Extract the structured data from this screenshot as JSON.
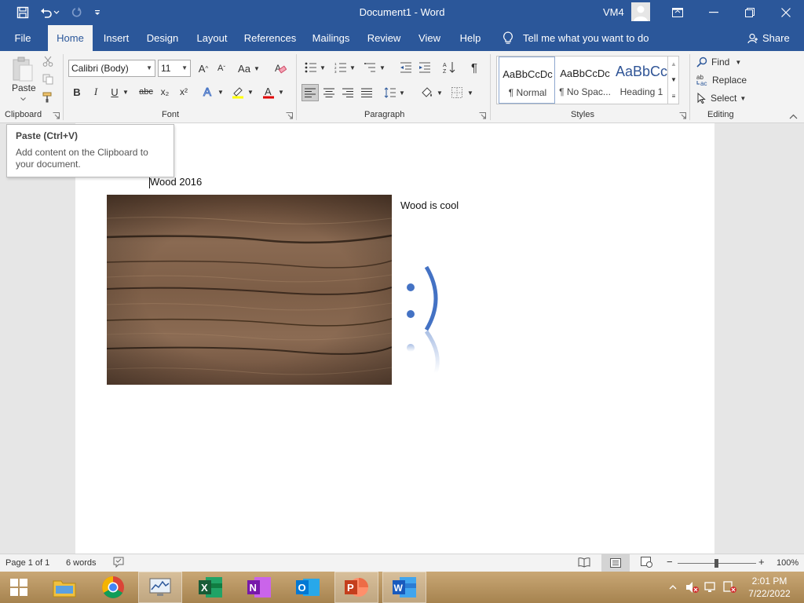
{
  "window": {
    "title": "Document1 - Word",
    "user": "VM4"
  },
  "tabs": [
    "File",
    "Home",
    "Insert",
    "Design",
    "Layout",
    "References",
    "Mailings",
    "Review",
    "View",
    "Help"
  ],
  "tell_me": "Tell me what you want to do",
  "share": "Share",
  "ribbon": {
    "clipboard": {
      "label": "Clipboard",
      "paste": "Paste"
    },
    "font": {
      "label": "Font",
      "family": "Calibri (Body)",
      "size": "11",
      "bold": "B",
      "italic": "I",
      "underline": "U",
      "strike": "abc",
      "subscript": "x₂",
      "superscript": "x²",
      "change_case": "Aa"
    },
    "paragraph": {
      "label": "Paragraph"
    },
    "styles": {
      "label": "Styles",
      "items": [
        {
          "preview": "AaBbCcDc",
          "name": "¶ Normal"
        },
        {
          "preview": "AaBbCcDc",
          "name": "¶ No Spac..."
        },
        {
          "preview": "AaBbCc",
          "name": "Heading 1"
        }
      ]
    },
    "editing": {
      "label": "Editing",
      "find": "Find",
      "replace": "Replace",
      "select": "Select"
    }
  },
  "tooltip": {
    "title": "Paste (Ctrl+V)",
    "description": "Add content on the Clipboard to your document."
  },
  "document": {
    "heading": "Wood 2016",
    "caption": "Wood is cool"
  },
  "status": {
    "page": "Page 1 of 1",
    "words": "6 words",
    "zoom": "100%"
  },
  "clock": {
    "time": "2:01 PM",
    "date": "7/22/2022"
  },
  "colors": {
    "accent": "#2b579a",
    "smiley": "#4472c4",
    "taskbar": "#b8955f"
  }
}
